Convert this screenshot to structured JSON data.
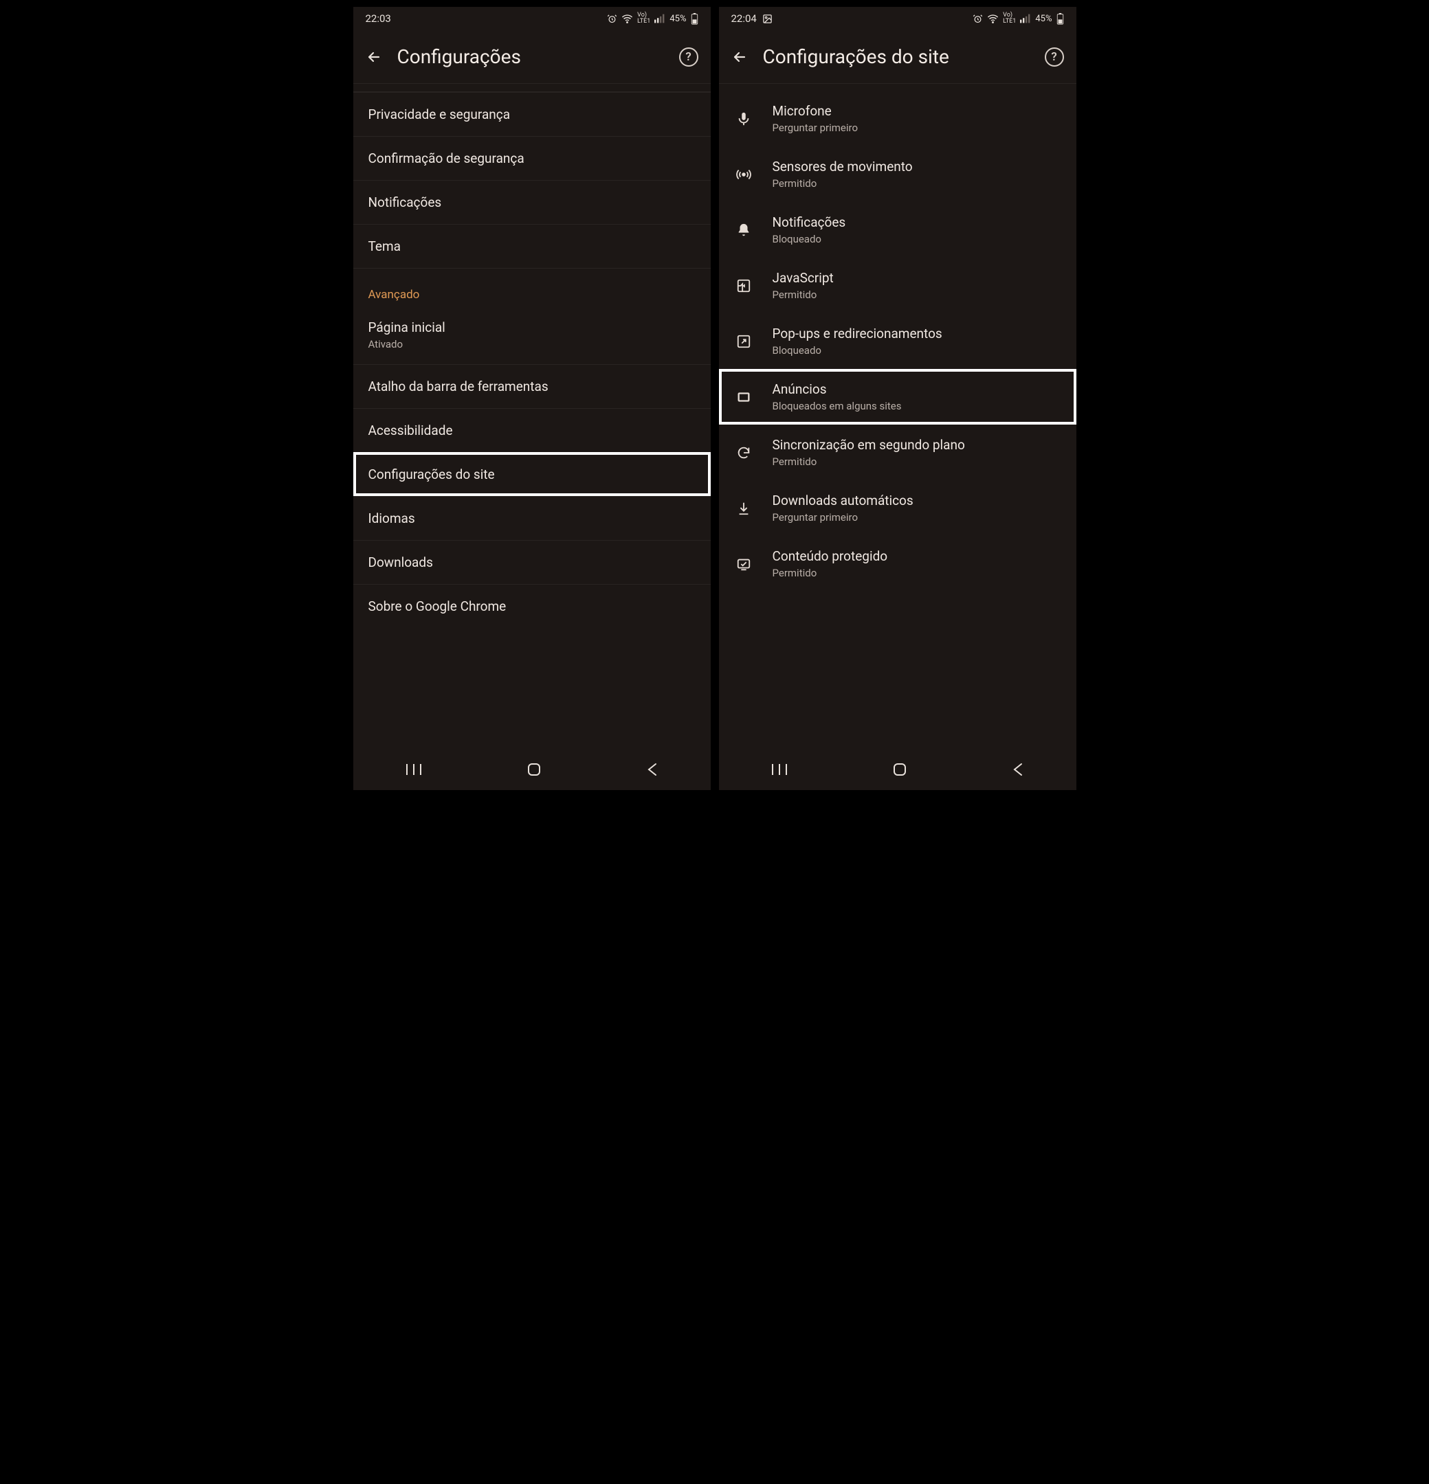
{
  "left": {
    "status_time": "22:03",
    "battery_text": "45%",
    "title": "Configurações",
    "rows": [
      {
        "label": "Privacidade e segurança"
      },
      {
        "label": "Confirmação de segurança"
      },
      {
        "label": "Notificações"
      },
      {
        "label": "Tema"
      }
    ],
    "section": "Avançado",
    "rows2": [
      {
        "label": "Página inicial",
        "sub": "Ativado"
      },
      {
        "label": "Atalho da barra de ferramentas"
      },
      {
        "label": "Acessibilidade"
      },
      {
        "label": "Configurações do site",
        "highlight": true
      },
      {
        "label": "Idiomas"
      },
      {
        "label": "Downloads"
      },
      {
        "label": "Sobre o Google Chrome"
      }
    ]
  },
  "right": {
    "status_time": "22:04",
    "battery_text": "45%",
    "title": "Configurações do site",
    "items": [
      {
        "icon": "mic",
        "label": "Microfone",
        "sub": "Perguntar primeiro"
      },
      {
        "icon": "motion",
        "label": "Sensores de movimento",
        "sub": "Permitido"
      },
      {
        "icon": "bell",
        "label": "Notificações",
        "sub": "Bloqueado"
      },
      {
        "icon": "js",
        "label": "JavaScript",
        "sub": "Permitido"
      },
      {
        "icon": "popup",
        "label": "Pop-ups e redirecionamentos",
        "sub": "Bloqueado"
      },
      {
        "icon": "ads",
        "label": "Anúncios",
        "sub": "Bloqueados em alguns sites",
        "highlight": true
      },
      {
        "icon": "sync",
        "label": "Sincronização em segundo plano",
        "sub": "Permitido"
      },
      {
        "icon": "download",
        "label": "Downloads automáticos",
        "sub": "Perguntar primeiro"
      },
      {
        "icon": "protected",
        "label": "Conteúdo protegido",
        "sub": "Permitido"
      }
    ]
  }
}
